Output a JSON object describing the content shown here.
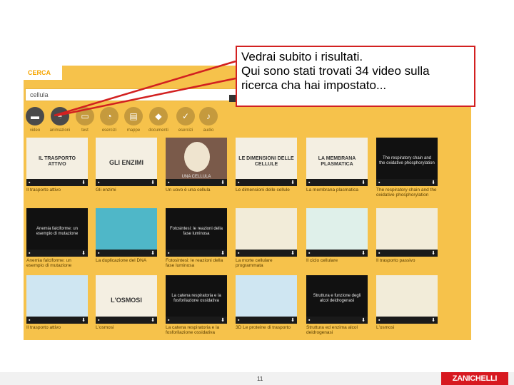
{
  "search": {
    "tab_label": "CERCA",
    "query": "cellula"
  },
  "filters": [
    {
      "label": "video",
      "icon": "video-icon",
      "active": true
    },
    {
      "label": "animazioni",
      "icon": "animation-icon",
      "active": true
    },
    {
      "label": "test",
      "icon": "test-icon",
      "active": false
    },
    {
      "label": "esercizi",
      "icon": "exercise-icon",
      "active": false
    },
    {
      "label": "mappe",
      "icon": "map-icon",
      "active": false
    },
    {
      "label": "documenti",
      "icon": "document-icon",
      "active": false
    },
    {
      "label": "esercizi",
      "icon": "check-icon",
      "active": false
    },
    {
      "label": "audio",
      "icon": "audio-icon",
      "active": false
    }
  ],
  "videos": [
    {
      "thumb_title": "IL TRASPORTO ATTIVO",
      "caption": "Il trasporto attivo"
    },
    {
      "thumb_title": "GLI ENZIMI",
      "caption": "Gli enzimi"
    },
    {
      "thumb_title": "UNA CELLULA",
      "caption": "Un uovo è una cellula"
    },
    {
      "thumb_title": "LE DIMENSIONI DELLE CELLULE",
      "caption": "Le dimensioni delle cellule"
    },
    {
      "thumb_title": "LA MEMBRANA PLASMATICA",
      "caption": "La membrana plasmatica"
    },
    {
      "thumb_title": "The respiratory chain and the oxidative phosphorylation",
      "caption": "The respiratory chain and the oxidative phosphorylation"
    },
    {
      "thumb_title": "Anemia falciforme: un esempio di mutazione",
      "caption": "Anemia falciforme: un esempio di mutazione"
    },
    {
      "thumb_title": "",
      "caption": "La duplicazione del DNA"
    },
    {
      "thumb_title": "Fotosintesi: le reazioni della fase luminosa",
      "caption": "Fotosintesi: le reazioni della fase luminosa"
    },
    {
      "thumb_title": "",
      "caption": "La morte cellulare programmata"
    },
    {
      "thumb_title": "",
      "caption": "Il ciclo cellulare"
    },
    {
      "thumb_title": "",
      "caption": "Il trasporto passivo"
    },
    {
      "thumb_title": "",
      "caption": "Il trasporto attivo"
    },
    {
      "thumb_title": "L'OSMOSI",
      "caption": "L'osmosi"
    },
    {
      "thumb_title": "La catena respiratoria e la fosforilazione ossidativa",
      "caption": "La catena respiratoria e la fosforilazione ossidativa"
    },
    {
      "thumb_title": "",
      "caption": "3D Le proteine di trasporto"
    },
    {
      "thumb_title": "Struttura e funzione degli alcol deidrogenasi",
      "caption": "Struttura ed enzima alcol deidrogenasi"
    },
    {
      "thumb_title": "",
      "caption": "L'osmosi"
    }
  ],
  "callout": {
    "line1": "Vedrai subito i risultati.",
    "line2": "Qui sono stati trovati 34 video sulla",
    "line3": "ricerca cha hai impostato..."
  },
  "footer": {
    "page_number": "11",
    "brand": "ZANICHELLI"
  },
  "colors": {
    "panel": "#f6c24b",
    "callout_border": "#d22020",
    "brand": "#d71920"
  }
}
